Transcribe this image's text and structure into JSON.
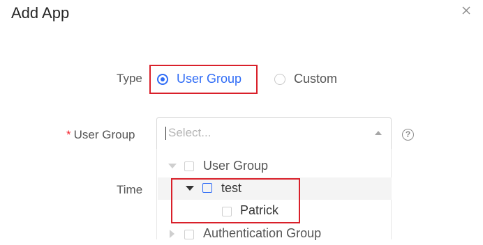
{
  "dialog": {
    "title": "Add App"
  },
  "form": {
    "type_label": "Type",
    "type_options": [
      {
        "label": "User Group",
        "selected": true
      },
      {
        "label": "Custom",
        "selected": false
      }
    ],
    "user_group_required_mark": "*",
    "user_group_label": "User Group",
    "user_group_placeholder": "Select...",
    "time_label": "Time"
  },
  "tree": [
    {
      "label": "User Group",
      "expanded": true,
      "checked": false,
      "disabled": true
    },
    {
      "label": "test",
      "expanded": true,
      "checked": false,
      "highlighted": true
    },
    {
      "label": "Patrick",
      "checked": false,
      "leaf": true
    },
    {
      "label": "Authentication Group",
      "expanded": false,
      "checked": false
    }
  ],
  "colors": {
    "accent": "#2f6cf6",
    "highlight_border": "#d9202a",
    "required": "#f5222d"
  }
}
